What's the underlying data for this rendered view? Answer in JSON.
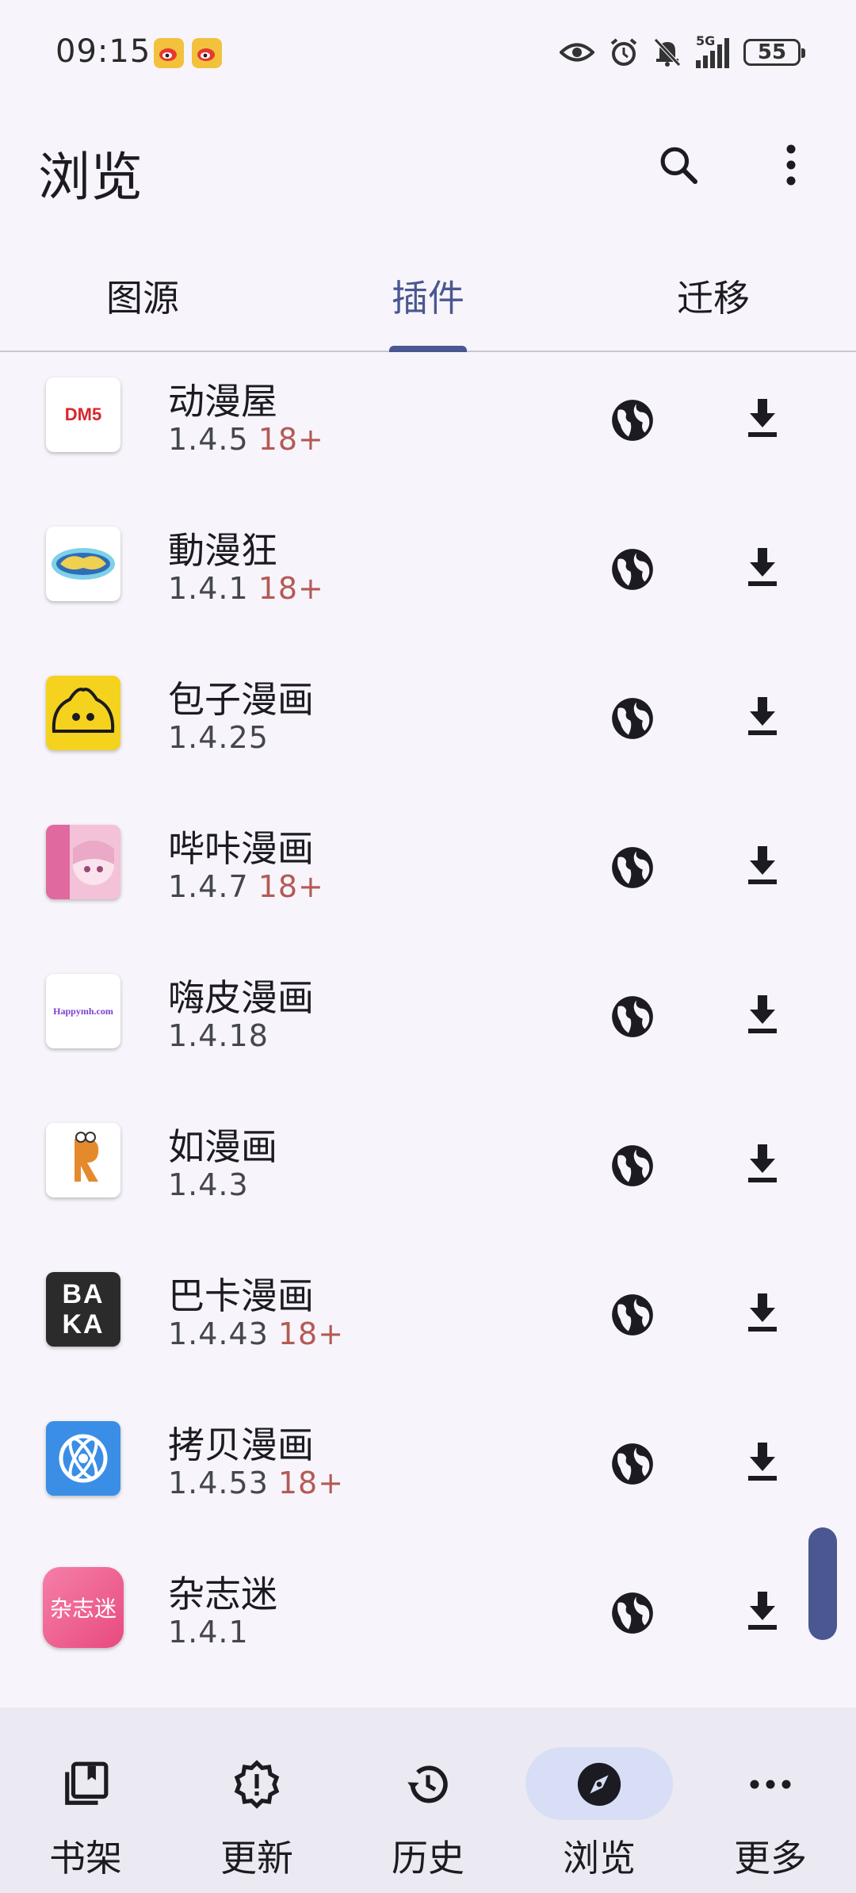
{
  "status_bar": {
    "time": "09:15",
    "battery": "55",
    "network": "5G"
  },
  "app_bar": {
    "title": "浏览",
    "search_icon": "search-icon",
    "more_icon": "more-vert-icon"
  },
  "tabs": [
    {
      "label": "图源"
    },
    {
      "label": "插件"
    },
    {
      "label": "迁移"
    }
  ],
  "active_tab": "插件",
  "plugins": [
    {
      "name": "动漫屋",
      "version": "1.4.5",
      "age": "18+",
      "logo": "DM5"
    },
    {
      "name": "動漫狂",
      "version": "1.4.1",
      "age": "18+",
      "logo": ""
    },
    {
      "name": "包子漫画",
      "version": "1.4.25",
      "age": "",
      "logo": ""
    },
    {
      "name": "哔咔漫画",
      "version": "1.4.7",
      "age": "18+",
      "logo": ""
    },
    {
      "name": "嗨皮漫画",
      "version": "1.4.18",
      "age": "",
      "logo": "Happymh.com"
    },
    {
      "name": "如漫画",
      "version": "1.4.3",
      "age": "",
      "logo": ""
    },
    {
      "name": "巴卡漫画",
      "version": "1.4.43",
      "age": "18+",
      "logo": "BAKA"
    },
    {
      "name": "拷贝漫画",
      "version": "1.4.53",
      "age": "18+",
      "logo": ""
    },
    {
      "name": "杂志迷",
      "version": "1.4.1",
      "age": "",
      "logo": "杂志迷"
    }
  ],
  "bottom_nav": [
    {
      "label": "书架",
      "icon": "library-icon"
    },
    {
      "label": "更新",
      "icon": "updates-icon"
    },
    {
      "label": "历史",
      "icon": "history-icon"
    },
    {
      "label": "浏览",
      "icon": "explore-icon"
    },
    {
      "label": "更多",
      "icon": "more-horiz-icon"
    }
  ],
  "active_nav": "浏览",
  "colors": {
    "accent": "#4a5790",
    "age_badge": "#b45a55",
    "background": "#f7f5fb",
    "nav_bg": "#ebe9f1"
  }
}
